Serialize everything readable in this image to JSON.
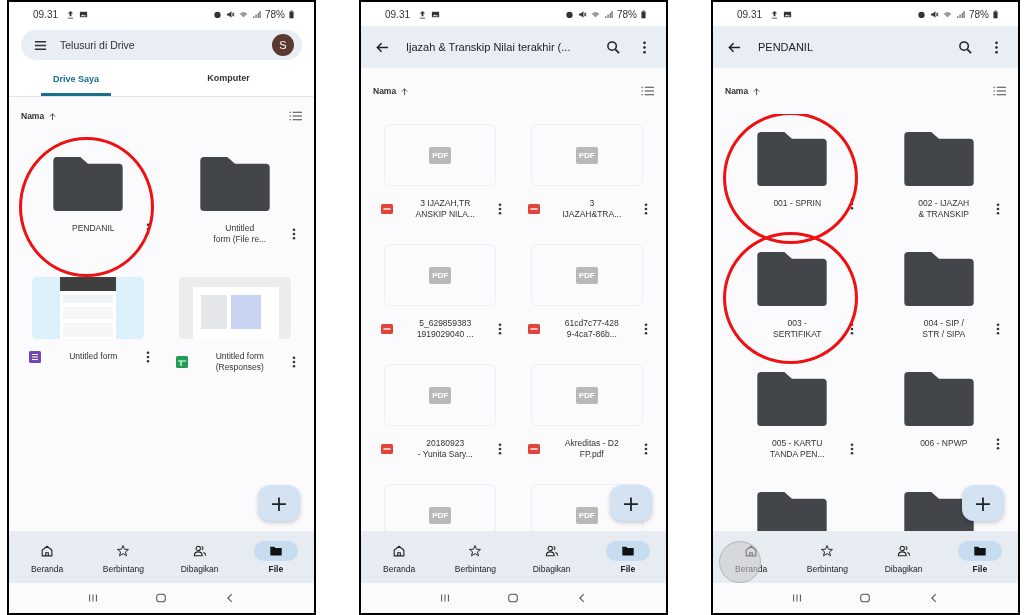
{
  "phones": [
    {
      "status": {
        "time": "09.31",
        "battery": "78%"
      },
      "header": {
        "kind": "search",
        "placeholder": "Telusuri di Drive",
        "avatar": "S"
      },
      "tabs": [
        {
          "label": "Drive Saya",
          "selected": true
        },
        {
          "label": "Komputer",
          "selected": false
        }
      ],
      "sort": "Nama",
      "items": [
        {
          "kind": "folder",
          "name": "PENDANIL",
          "highlighted": true
        },
        {
          "kind": "folder",
          "name": "Untitled\nform (File re..."
        },
        {
          "kind": "form",
          "name": "Untitled form"
        },
        {
          "kind": "sheet",
          "name": "Untitled form\n(Responses)"
        }
      ],
      "fab": "+",
      "nav": [
        {
          "kind": "home",
          "label": "Beranda",
          "selected": false
        },
        {
          "kind": "star",
          "label": "Berbintang",
          "selected": false
        },
        {
          "kind": "people",
          "label": "Dibagikan",
          "selected": false
        },
        {
          "kind": "folder",
          "label": "File",
          "selected": true
        }
      ]
    },
    {
      "status": {
        "time": "09.31",
        "battery": "78%"
      },
      "header": {
        "kind": "title",
        "title": "Ijazah & Transkip Nilai terakhir (..."
      },
      "sort": "Nama",
      "items": [
        {
          "kind": "pdf",
          "thumb_label": "PDF",
          "name": "3 IJAZAH,TR\nANSKIP NILA..."
        },
        {
          "kind": "pdf",
          "thumb_label": "PDF",
          "name": "3\nIJAZAH&TRA..."
        },
        {
          "kind": "pdf",
          "thumb_label": "PDF",
          "name": "5_629859383\n1919029040 ..."
        },
        {
          "kind": "pdf",
          "thumb_label": "PDF",
          "name": "61cd7c77-428\n9-4ca7-86b..."
        },
        {
          "kind": "pdf",
          "thumb_label": "PDF",
          "name": "20180923\n- Yunita Sary..."
        },
        {
          "kind": "pdf",
          "thumb_label": "PDF",
          "name": "Akreditas - D2\nFP.pdf"
        },
        {
          "kind": "pdf",
          "thumb_label": "PDF"
        },
        {
          "kind": "pdf",
          "thumb_label": "PDF"
        }
      ],
      "fab": "+",
      "nav": [
        {
          "kind": "home",
          "label": "Beranda",
          "selected": false
        },
        {
          "kind": "star",
          "label": "Berbintang",
          "selected": false
        },
        {
          "kind": "people",
          "label": "Dibagikan",
          "selected": false
        },
        {
          "kind": "folder",
          "label": "File",
          "selected": true
        }
      ]
    },
    {
      "status": {
        "time": "09.31",
        "battery": "78%"
      },
      "header": {
        "kind": "title",
        "title": "PENDANIL"
      },
      "sort": "Nama",
      "items": [
        {
          "kind": "folder",
          "name": "001 - SPRIN",
          "highlighted": true
        },
        {
          "kind": "folder",
          "name": "002 - IJAZAH\n& TRANSKIP"
        },
        {
          "kind": "folder",
          "name": "003 -\nSERTIFIKAT",
          "highlighted": true
        },
        {
          "kind": "folder",
          "name": "004 - SIP /\nSTR / SIPA"
        },
        {
          "kind": "folder",
          "name": "005 - KARTU\nTANDA PEN..."
        },
        {
          "kind": "folder",
          "name": "006 - NPWP"
        },
        {
          "kind": "folder"
        },
        {
          "kind": "folder"
        }
      ],
      "fab": "+",
      "touch": true,
      "nav": [
        {
          "kind": "home",
          "label": "Beranda",
          "selected": false
        },
        {
          "kind": "star",
          "label": "Berbintang",
          "selected": false
        },
        {
          "kind": "people",
          "label": "Dibagikan",
          "selected": false
        },
        {
          "kind": "folder",
          "label": "File",
          "selected": true
        }
      ]
    }
  ]
}
